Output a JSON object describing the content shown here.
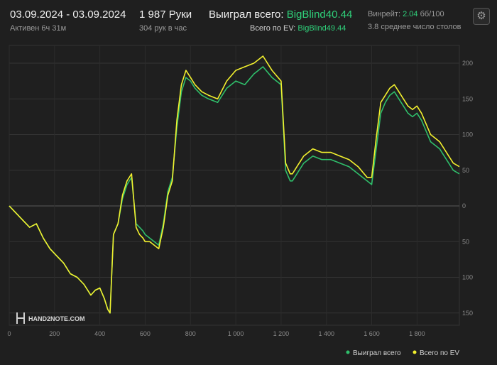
{
  "header": {
    "date_range": "03.09.2024 - 03.09.2024",
    "active": "Активен 6ч 31м",
    "hands": "1 987 Руки",
    "hands_per_hour": "304 рук в час",
    "won_label": "Выиграл всего:",
    "won_value": "BigBlind40.44",
    "ev_label": "Всего по EV:",
    "ev_value": "BigBlind49.44",
    "winrate_label": "Винрейт:",
    "winrate_value": "2.04",
    "winrate_unit": "бб/100",
    "avg_tables": "3.8 среднее число столов"
  },
  "watermark": {
    "text": "HAND2NOTE.COM"
  },
  "colors": {
    "won": "#2fbf6b",
    "ev": "#f2f02e",
    "background": "#1f1f1f",
    "grid": "#343434",
    "zero": "#5a5a5a"
  },
  "chart_data": {
    "type": "line",
    "title": "",
    "xlabel": "",
    "ylabel": "",
    "xlim": [
      0,
      1987
    ],
    "ylim": [
      -150,
      220
    ],
    "x_ticks": [
      0,
      200,
      400,
      600,
      800,
      1000,
      1200,
      1400,
      1600,
      1800
    ],
    "x_tick_labels": [
      "0",
      "200",
      "400",
      "600",
      "800",
      "1 000",
      "1 200",
      "1 400",
      "1 600",
      "1 800"
    ],
    "y_ticks": [
      200,
      150,
      100,
      50,
      0,
      -50,
      -100,
      -150
    ],
    "y_tick_labels": [
      "200",
      "150",
      "100",
      "50",
      "0",
      "50",
      "100",
      "150"
    ],
    "grid": true,
    "legend_position": "bottom-right",
    "series": [
      {
        "name": "Выиграл всего",
        "color": "#2fbf6b",
        "x": [
          0,
          30,
          60,
          90,
          120,
          150,
          180,
          210,
          240,
          270,
          300,
          330,
          360,
          380,
          400,
          420,
          435,
          445,
          460,
          480,
          500,
          520,
          540,
          560,
          575,
          590,
          600,
          620,
          640,
          660,
          680,
          700,
          720,
          740,
          760,
          780,
          800,
          820,
          850,
          880,
          920,
          960,
          1000,
          1040,
          1080,
          1120,
          1160,
          1200,
          1220,
          1240,
          1250,
          1270,
          1300,
          1340,
          1380,
          1420,
          1460,
          1500,
          1540,
          1580,
          1600,
          1620,
          1640,
          1660,
          1680,
          1700,
          1720,
          1740,
          1760,
          1780,
          1800,
          1820,
          1840,
          1860,
          1880,
          1900,
          1920,
          1940,
          1960,
          1987
        ],
        "y": [
          0,
          -10,
          -20,
          -30,
          -25,
          -45,
          -60,
          -70,
          -80,
          -95,
          -100,
          -110,
          -125,
          -118,
          -115,
          -130,
          -145,
          -150,
          -40,
          -25,
          10,
          30,
          40,
          -25,
          -30,
          -35,
          -40,
          -45,
          -50,
          -55,
          -25,
          20,
          40,
          110,
          160,
          180,
          175,
          165,
          155,
          150,
          145,
          165,
          175,
          170,
          185,
          195,
          180,
          170,
          50,
          35,
          35,
          45,
          60,
          70,
          65,
          65,
          60,
          55,
          45,
          35,
          30,
          80,
          130,
          145,
          155,
          160,
          150,
          140,
          130,
          125,
          130,
          120,
          105,
          90,
          85,
          80,
          70,
          60,
          50,
          45
        ]
      },
      {
        "name": "Всего по EV",
        "color": "#f2f02e",
        "x": [
          0,
          30,
          60,
          90,
          120,
          150,
          180,
          210,
          240,
          270,
          300,
          330,
          360,
          380,
          400,
          420,
          435,
          445,
          460,
          480,
          500,
          520,
          540,
          560,
          575,
          590,
          600,
          620,
          640,
          660,
          680,
          700,
          720,
          740,
          760,
          780,
          800,
          820,
          850,
          880,
          920,
          960,
          1000,
          1040,
          1080,
          1120,
          1160,
          1200,
          1220,
          1240,
          1250,
          1270,
          1300,
          1340,
          1380,
          1420,
          1460,
          1500,
          1540,
          1580,
          1600,
          1620,
          1640,
          1660,
          1680,
          1700,
          1720,
          1740,
          1760,
          1780,
          1800,
          1820,
          1840,
          1860,
          1880,
          1900,
          1920,
          1940,
          1960,
          1987
        ],
        "y": [
          0,
          -10,
          -20,
          -30,
          -25,
          -45,
          -60,
          -70,
          -80,
          -95,
          -100,
          -110,
          -125,
          -118,
          -115,
          -130,
          -145,
          -150,
          -40,
          -25,
          15,
          35,
          45,
          -30,
          -40,
          -45,
          -50,
          -50,
          -55,
          -60,
          -30,
          15,
          35,
          120,
          170,
          190,
          180,
          170,
          160,
          155,
          150,
          175,
          190,
          195,
          200,
          210,
          190,
          175,
          60,
          45,
          45,
          55,
          70,
          80,
          75,
          75,
          70,
          65,
          55,
          40,
          40,
          95,
          145,
          155,
          165,
          170,
          160,
          150,
          140,
          135,
          140,
          130,
          115,
          100,
          95,
          90,
          80,
          70,
          60,
          55
        ]
      }
    ]
  }
}
